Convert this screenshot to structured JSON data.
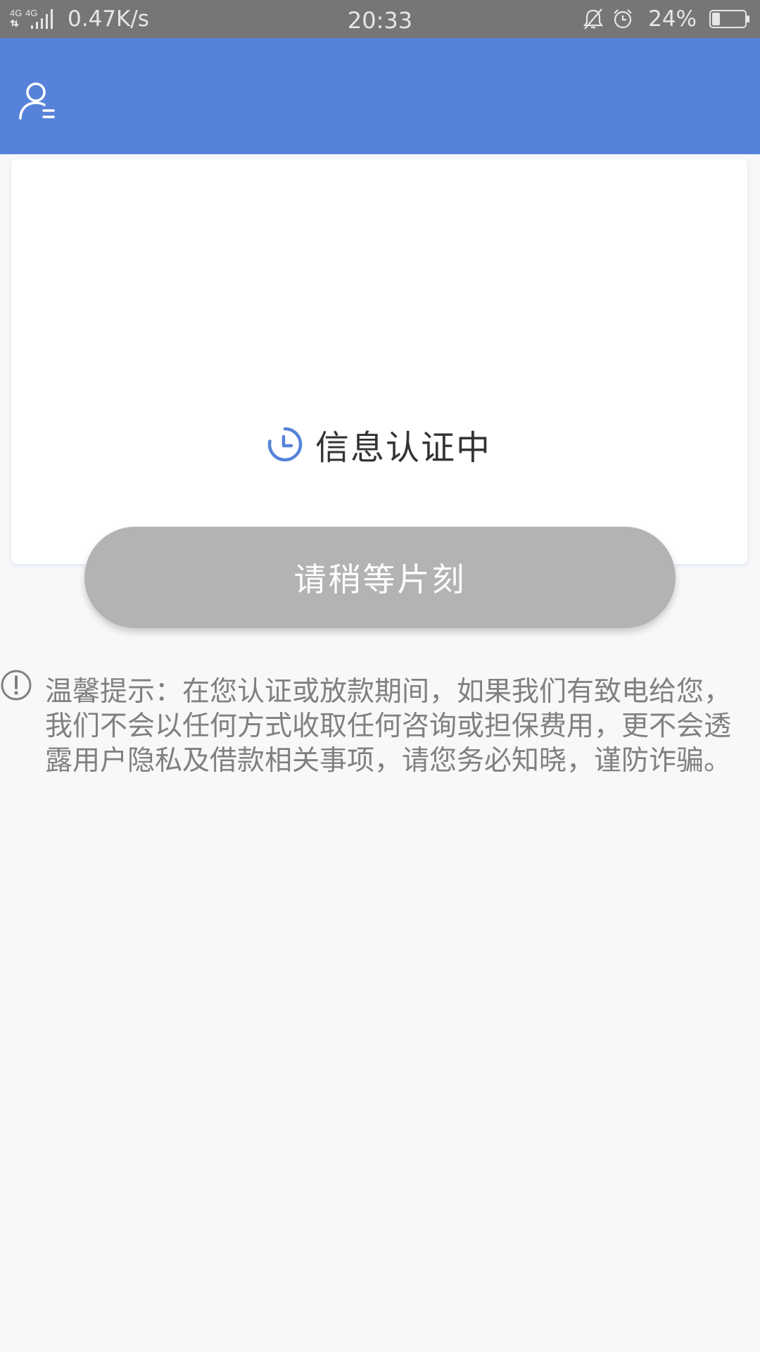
{
  "status_bar": {
    "network_label": "4G 4G",
    "net_speed": "0.47K/s",
    "time": "20:33",
    "battery_percent": "24%",
    "battery_level": 0.24,
    "icons": [
      "signal-icon",
      "mute-icon",
      "alarm-icon",
      "battery-icon"
    ]
  },
  "header": {
    "profile_icon": "user-profile-icon"
  },
  "card": {
    "status_icon": "clock-icon",
    "status_text": "信息认证中"
  },
  "button": {
    "label": "请稍等片刻"
  },
  "tip": {
    "icon": "warning-icon",
    "text": "温馨提示：在您认证或放款期间，如果我们有致电给您，我们不会以任何方式收取任何咨询或担保费用，更不会透露用户隐私及借款相关事项，请您务必知晓，谨防诈骗。"
  },
  "colors": {
    "header_bg": "#5683d9",
    "status_bar_bg": "#767676",
    "button_bg": "#b3b3b3",
    "page_bg": "#f8f8f8"
  }
}
